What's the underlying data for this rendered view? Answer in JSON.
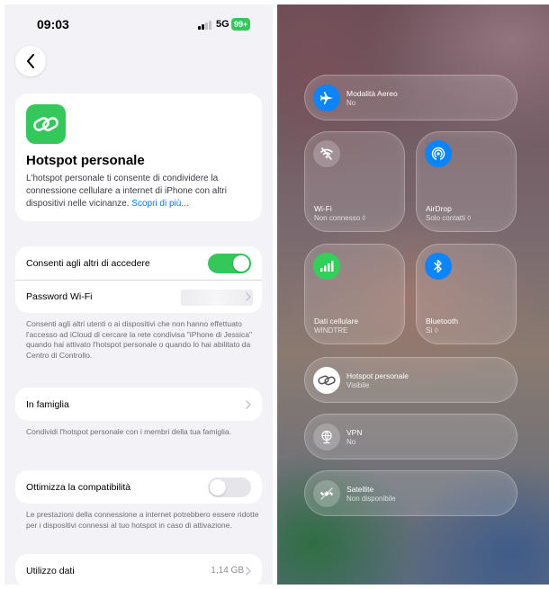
{
  "left": {
    "status": {
      "time": "09:03",
      "network": "5G",
      "battery": "99+"
    },
    "hero": {
      "title": "Hotspot personale",
      "description": "L'hotspot personale ti consente di condividere la connessione cellulare a internet di iPhone con altri dispositivi nelle vicinanze.",
      "link": "Scopri di più..."
    },
    "access": {
      "allow_label": "Consenti agli altri di accedere",
      "allow_on": true,
      "password_label": "Password Wi-Fi",
      "footer": "Consenti agli altri utenti o ai dispositivi che non hanno effettuato l'accesso ad iCloud di cercare la rete condivisa \"iPhone di Jessica\" quando hai attivato l'hotspot personale o quando lo hai abilitato da Centro di Controllo."
    },
    "family": {
      "label": "In famiglia",
      "footer": "Condividi l'hotspot personale con i membri della tua famiglia."
    },
    "compat": {
      "label": "Ottimizza la compatibilità",
      "on": false,
      "footer": "Le prestazioni della connessione a internet potrebbero essere ridotte per i dispositivi connessi al tuo hotspot in caso di attivazione."
    },
    "data_usage": {
      "label": "Utilizzo dati",
      "value": "1,14 GB"
    }
  },
  "right": {
    "airplane": {
      "label": "Modalità Aereo",
      "status": "No"
    },
    "wifi": {
      "label": "Wi-Fi",
      "status": "Non connesso ◊"
    },
    "airdrop": {
      "label": "AirDrop",
      "status": "Solo contatti ◊"
    },
    "cellular": {
      "label": "Dati cellulare",
      "status": "WINDTRE"
    },
    "bluetooth": {
      "label": "Bluetooth",
      "status": "Sì ◊"
    },
    "hotspot": {
      "label": "Hotspot personale",
      "status": "Visibile"
    },
    "vpn": {
      "label": "VPN",
      "status": "No"
    },
    "satellite": {
      "label": "Satellite",
      "status": "Non disponibile"
    }
  },
  "colors": {
    "accent_green": "#34c759",
    "link_blue": "#007aff",
    "control_blue": "#0a84ff"
  }
}
